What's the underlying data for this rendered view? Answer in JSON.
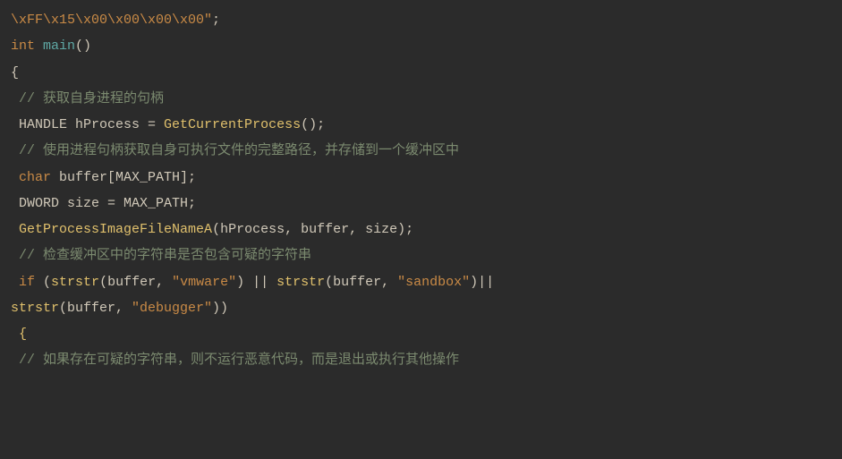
{
  "code": {
    "l1": {
      "str": "\\xFF\\x15\\x00\\x00\\x00\\x00\"",
      "semi": ";"
    },
    "l2": {
      "kw": "int",
      "sp": " ",
      "fn": "main",
      "paren": "()"
    },
    "l3": {
      "brace": "{"
    },
    "l4": {
      "pad": " ",
      "comment": "// 获取自身进程的句柄"
    },
    "l5": {
      "pad": " ",
      "txt1": "HANDLE hProcess = ",
      "fn": "GetCurrentProcess",
      "rest": "();"
    },
    "l6": {
      "pad": " ",
      "comment": "// 使用进程句柄获取自身可执行文件的完整路径，并存储到一个缓冲区中"
    },
    "l7": {
      "pad": " ",
      "kw": "char",
      "rest": " buffer[MAX_PATH];"
    },
    "l8": {
      "pad": " ",
      "txt": "DWORD size = MAX_PATH;"
    },
    "l9": {
      "pad": " ",
      "fn": "GetProcessImageFileNameA",
      "rest": "(hProcess, buffer, size);"
    },
    "l10": {
      "pad": " ",
      "comment": "// 检查缓冲区中的字符串是否包含可疑的字符串"
    },
    "l11": {
      "pad": " ",
      "kw": "if",
      "t1": " (",
      "fn1": "strstr",
      "t2": "(buffer, ",
      "s1": "\"vmware\"",
      "t3": ") || ",
      "fn2": "strstr",
      "t4": "(buffer, ",
      "s2": "\"sandbox\"",
      "t5": ")||"
    },
    "l12": {
      "fn": "strstr",
      "t1": "(buffer, ",
      "s1": "\"debugger\"",
      "t2": "))"
    },
    "l13": {
      "pad": " ",
      "brace": "{"
    },
    "l14": {
      "pad": " ",
      "comment": "// 如果存在可疑的字符串，则不运行恶意代码，而是退出或执行其他操作"
    }
  }
}
